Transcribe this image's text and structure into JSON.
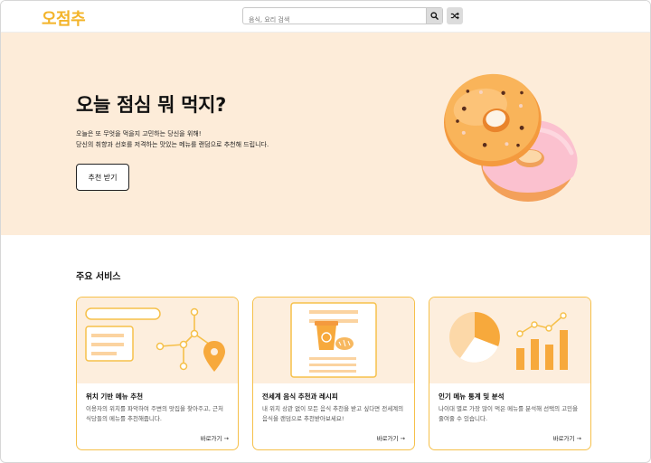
{
  "header": {
    "logo": "오점추",
    "search_placeholder": "음식, 요리 검색",
    "search_icon": "search-icon",
    "shuffle_icon": "shuffle-icon"
  },
  "hero": {
    "title": "오늘 점심 뭐 먹지?",
    "desc_line1": "오늘은 또 무엇을 먹을지 고민하는 당신을 위해!",
    "desc_line2": "당신의 취향과 선호를 저격하는 맛있는 메뉴를 랜덤으로 추천해 드립니다.",
    "button_label": "추천 받기",
    "image": "donut-illustration"
  },
  "services": {
    "title": "주요 서비스",
    "cards": [
      {
        "title": "위치 기반 메뉴 추천",
        "desc": "이용자의 위치를 파악하여 주변의 맛집을 찾아주고, 근처 식당들의 메뉴를 추천해줍니다.",
        "link": "바로가기 →",
        "illustration": "location-map-illustration"
      },
      {
        "title": "전세계 음식 추천과 레시피",
        "desc": "내 위치 상관 없이 모든 음식 추천을 받고 싶다면 전세계의 음식을 랜덤으로 추천받아보세요!",
        "link": "바로가기 →",
        "illustration": "coffee-bread-illustration"
      },
      {
        "title": "인기 메뉴 통계 및 분석",
        "desc": "나이대 별로 가장 많이 먹은 메뉴를 분석해 선택의 고민을 줄여줄 수 있습니다.",
        "link": "바로가기 →",
        "illustration": "stats-chart-illustration"
      }
    ]
  },
  "colors": {
    "brand": "#f3b42a",
    "hero_bg": "#fdecd9",
    "card_border": "#f6c04a",
    "accent_orange": "#f7a740"
  }
}
